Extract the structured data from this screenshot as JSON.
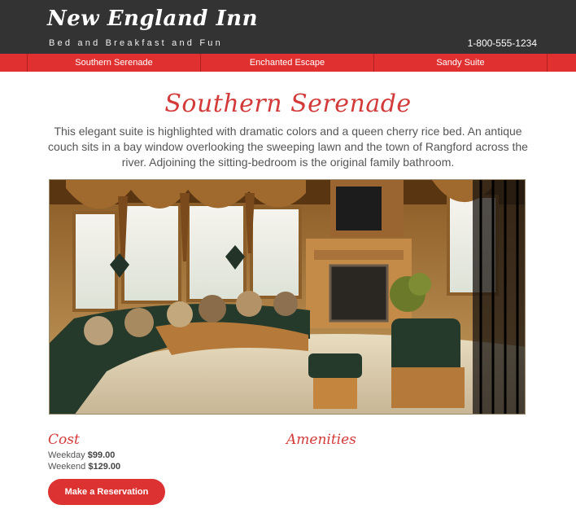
{
  "header": {
    "brand": "New England Inn",
    "tagline": "Bed and Breakfast and Fun",
    "phone": "1-800-555-1234"
  },
  "nav": {
    "items": [
      {
        "label": "Southern Serenade"
      },
      {
        "label": "Enchanted Escape"
      },
      {
        "label": "Sandy Suite"
      }
    ]
  },
  "suite": {
    "title": "Southern Serenade",
    "description": "This elegant suite is highlighted with dramatic colors and a queen cherry rice bed. An antique couch sits in a bay window overlooking the sweeping lawn and the town of Rangford across the river. Adjoining the sitting-bedroom is the original family bathroom."
  },
  "cost": {
    "heading": "Cost",
    "rates": [
      {
        "label": "Weekday",
        "price": "$99.00"
      },
      {
        "label": "Weekend",
        "price": "$129.00"
      }
    ]
  },
  "amenities": {
    "heading": "Amenities"
  },
  "actions": {
    "reserve_label": "Make a Reservation"
  },
  "colors": {
    "accent": "#e03030",
    "header_bg": "#333333",
    "title": "#d33a3a"
  }
}
